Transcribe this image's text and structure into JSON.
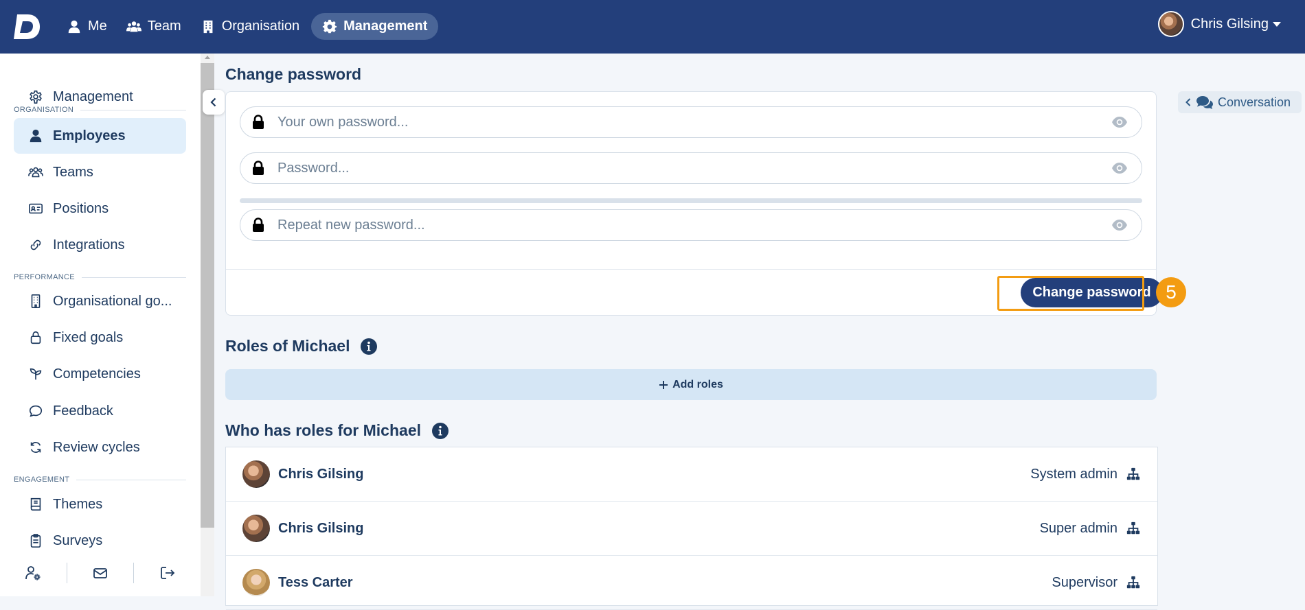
{
  "topbar": {
    "logo_letter": "D",
    "nav": [
      {
        "label": "Me",
        "icon": "user-icon"
      },
      {
        "label": "Team",
        "icon": "users-icon"
      },
      {
        "label": "Organisation",
        "icon": "building-icon"
      },
      {
        "label": "Management",
        "icon": "gear-icon",
        "active": true
      }
    ],
    "user_name": "Chris Gilsing"
  },
  "sidebar": {
    "top_item": "Management",
    "sections": {
      "organisation": "ORGANISATION",
      "performance": "PERFORMANCE",
      "engagement": "ENGAGEMENT"
    },
    "items": [
      {
        "label": "Employees",
        "active": true
      },
      {
        "label": "Teams"
      },
      {
        "label": "Positions"
      },
      {
        "label": "Integrations"
      },
      {
        "label": "Organisational go..."
      },
      {
        "label": "Fixed goals"
      },
      {
        "label": "Competencies"
      },
      {
        "label": "Feedback"
      },
      {
        "label": "Review cycles"
      },
      {
        "label": "Themes"
      },
      {
        "label": "Surveys"
      }
    ]
  },
  "change_password": {
    "title": "Change password",
    "own_placeholder": "Your own password...",
    "new_placeholder": "Password...",
    "repeat_placeholder": "Repeat new password...",
    "button_label": "Change password",
    "step_number": "5"
  },
  "roles": {
    "title": "Roles of Michael",
    "add_label": "Add roles"
  },
  "who_has_roles": {
    "title": "Who has roles for Michael",
    "rows": [
      {
        "name": "Chris Gilsing",
        "role": "System admin"
      },
      {
        "name": "Chris Gilsing",
        "role": "Super admin"
      },
      {
        "name": "Tess Carter",
        "role": "Supervisor"
      }
    ]
  },
  "conversation": {
    "label": "Conversation"
  },
  "colors": {
    "brand": "#233f7b",
    "highlight": "#f39c12",
    "active_bg": "#e1effb"
  }
}
